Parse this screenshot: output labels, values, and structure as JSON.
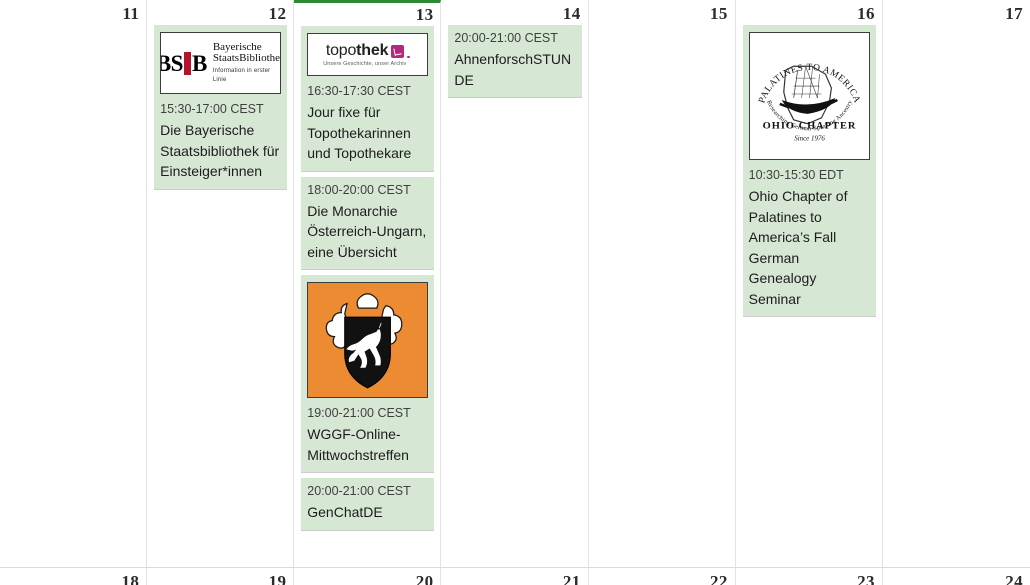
{
  "calendar": {
    "today_accent_color": "#2d8a33",
    "event_background_color": "#d6e8d3",
    "week_main": [
      {
        "day": "11",
        "is_today": false,
        "events": []
      },
      {
        "day": "12",
        "is_today": false,
        "events": [
          {
            "logo": "bsb-logo",
            "logo_text": {
              "mark_left": "BS",
              "mark_right": "B",
              "line1": "Bayerische",
              "line2": "StaatsBibliothek",
              "line3": "Information in erster Linie",
              "accent_color": "#b5122b"
            },
            "time": "15:30-17:00 CEST",
            "title": "Die Bayerische Staatsbibliothek für Einsteiger*innen"
          }
        ]
      },
      {
        "day": "13",
        "is_today": true,
        "events": [
          {
            "logo": "topothek-logo",
            "logo_text": {
              "word_light": "topo",
              "word_bold": "thek",
              "tagline": "Unsere Geschichte, unser Archiv",
              "accent_color": "#b4297a"
            },
            "time": "16:30-17:30 CEST",
            "title": "Jour fixe für Topothekarinnen und Topothekare"
          },
          {
            "logo": null,
            "time": "18:00-20:00 CEST",
            "title": "Die Monarchie Österreich-Ungarn, eine Übersicht"
          },
          {
            "logo": "wggf-horse-logo",
            "logo_text": {
              "background_color": "#ed8b33",
              "description": "White rearing horse on black shield"
            },
            "time": "19:00-21:00 CEST",
            "title": "WGGF-Online-Mittwochstreffen"
          },
          {
            "logo": null,
            "time": "20:00-21:00 CEST",
            "title": "GenChatDE"
          }
        ]
      },
      {
        "day": "14",
        "is_today": false,
        "events": [
          {
            "logo": null,
            "time": "20:00-21:00 CEST",
            "title": "AhnenforschSTUNDE"
          }
        ]
      },
      {
        "day": "15",
        "is_today": false,
        "events": []
      },
      {
        "day": "16",
        "is_today": false,
        "events": [
          {
            "logo": "palatines-to-america-logo",
            "logo_text": {
              "arc_top": "PALATINES TO AMERICA",
              "arc_bottom": "Researching German-Speaking Ancestry",
              "center": "OHIO CHAPTER",
              "since": "Since 1976"
            },
            "time": "10:30-15:30 EDT",
            "title": "Ohio Chapter of Palatines to America’s Fall German Genealogy Seminar"
          }
        ]
      },
      {
        "day": "17",
        "is_today": false,
        "events": []
      }
    ],
    "week_next": [
      {
        "day": "18"
      },
      {
        "day": "19"
      },
      {
        "day": "20"
      },
      {
        "day": "21"
      },
      {
        "day": "22"
      },
      {
        "day": "23"
      },
      {
        "day": "24"
      }
    ]
  }
}
